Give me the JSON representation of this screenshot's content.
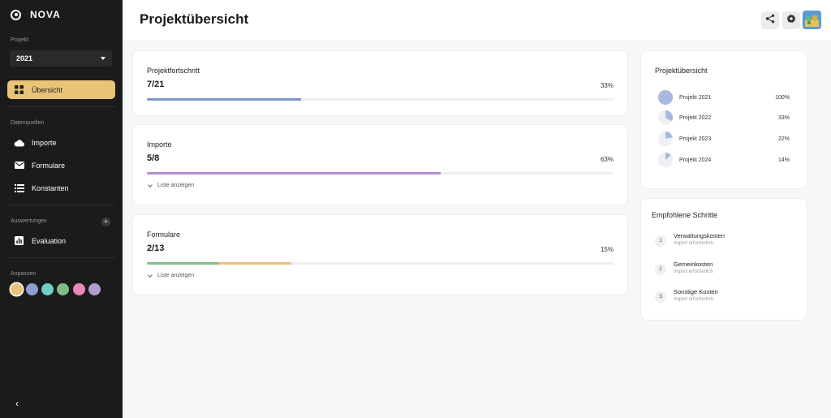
{
  "app": {
    "name": "NOVA"
  },
  "sidebar": {
    "project_label": "Projekt",
    "year_selected": "2021",
    "nav_main": [
      {
        "label": "Übersicht",
        "icon": "grid-icon",
        "active": true
      }
    ],
    "datasources_label": "Datenquellen",
    "nav_sources": [
      {
        "label": "Importe",
        "icon": "cloud-icon"
      },
      {
        "label": "Formulare",
        "icon": "mail-icon"
      },
      {
        "label": "Konstanten",
        "icon": "list-icon"
      }
    ],
    "evaluations_label": "Auswertungen",
    "nav_evaluations": [
      {
        "label": "Evaluation",
        "icon": "chart-icon"
      }
    ],
    "customize_label": "Anpassen",
    "swatches": [
      "#e8c378",
      "#8c9fd4",
      "#6fcfc4",
      "#7cbf84",
      "#e889b4",
      "#b49ad2"
    ]
  },
  "header": {
    "title": "Projektübersicht"
  },
  "cards": [
    {
      "title": "Projektfortschritt",
      "count": "7/21",
      "pct": "33%",
      "progress": 0.33,
      "colors": [
        "#7b96c8"
      ],
      "segments": [
        0.33
      ],
      "show_list": false
    },
    {
      "title": "Importe",
      "count": "5/8",
      "pct": "63%",
      "progress": 0.63,
      "colors": [
        "#b48fce"
      ],
      "segments": [
        0.63
      ],
      "show_list": true,
      "list_label": "Liste anzeigen"
    },
    {
      "title": "Formulare",
      "count": "2/13",
      "pct": "15%",
      "progress": 0.15,
      "colors": [
        "#82c08c",
        "#e8c378"
      ],
      "segments": [
        0.155,
        0.31
      ],
      "show_list": true,
      "list_label": "Liste anzeigen"
    }
  ],
  "overview": {
    "title": "Projektübersicht",
    "projects": [
      {
        "name": "Projekt 2021",
        "pct": "100%",
        "fraction": 1.0
      },
      {
        "name": "Projekt 2022",
        "pct": "33%",
        "fraction": 0.33
      },
      {
        "name": "Projekt 2023",
        "pct": "22%",
        "fraction": 0.22
      },
      {
        "name": "Projekt 2024",
        "pct": "14%",
        "fraction": 0.14
      }
    ]
  },
  "steps": {
    "title": "Empfohlene Schritte",
    "items": [
      {
        "num": "1",
        "title": "Verwaltungskosten",
        "sub": "Import erforderlich"
      },
      {
        "num": "2",
        "title": "Gemeinkosten",
        "sub": "Import erforderlich"
      },
      {
        "num": "3",
        "title": "Sonstige Kosten",
        "sub": "Import erforderlich"
      }
    ]
  },
  "colors": {
    "accent": "#e8c378",
    "pie": "#a9b9dd",
    "pie_bg": "#eef0f4"
  }
}
